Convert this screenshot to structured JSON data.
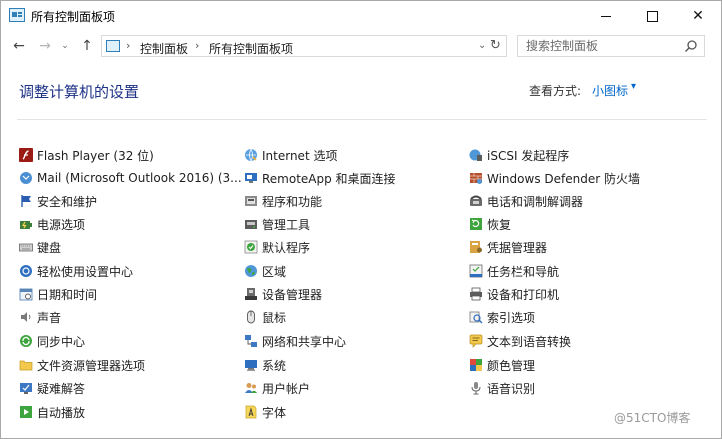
{
  "window": {
    "title": "所有控制面板项"
  },
  "titlebar": {
    "minimize": "—",
    "maximize": "□",
    "close": "✕"
  },
  "nav": {
    "back": "←",
    "forward": "→",
    "recent": "⌄",
    "up": "↑",
    "breadcrumb": [
      "控制面板",
      "所有控制面板项"
    ],
    "separator": "›",
    "refresh": "↻",
    "dropdown": "⌄"
  },
  "search": {
    "placeholder": "搜索控制面板"
  },
  "header": {
    "title": "调整计算机的设置",
    "view_label": "查看方式:",
    "view_value": "小图标",
    "view_caret": "▾"
  },
  "columns": [
    [
      {
        "label": "Flash Player (32 位)",
        "icon": "flash-icon"
      },
      {
        "label": "Mail (Microsoft Outlook 2016) (3...",
        "icon": "mail-icon"
      },
      {
        "label": "安全和维护",
        "icon": "flag-icon"
      },
      {
        "label": "电源选项",
        "icon": "power-icon"
      },
      {
        "label": "键盘",
        "icon": "keyboard-icon"
      },
      {
        "label": "轻松使用设置中心",
        "icon": "ease-of-access-icon"
      },
      {
        "label": "日期和时间",
        "icon": "calendar-icon"
      },
      {
        "label": "声音",
        "icon": "speaker-icon"
      },
      {
        "label": "同步中心",
        "icon": "sync-icon"
      },
      {
        "label": "文件资源管理器选项",
        "icon": "folder-icon"
      },
      {
        "label": "疑难解答",
        "icon": "troubleshoot-icon"
      },
      {
        "label": "自动播放",
        "icon": "autoplay-icon"
      }
    ],
    [
      {
        "label": "Internet 选项",
        "icon": "internet-icon"
      },
      {
        "label": "RemoteApp 和桌面连接",
        "icon": "remote-icon"
      },
      {
        "label": "程序和功能",
        "icon": "programs-icon"
      },
      {
        "label": "管理工具",
        "icon": "admin-tools-icon"
      },
      {
        "label": "默认程序",
        "icon": "default-programs-icon"
      },
      {
        "label": "区域",
        "icon": "region-icon"
      },
      {
        "label": "设备管理器",
        "icon": "device-manager-icon"
      },
      {
        "label": "鼠标",
        "icon": "mouse-icon"
      },
      {
        "label": "网络和共享中心",
        "icon": "network-icon"
      },
      {
        "label": "系统",
        "icon": "system-icon"
      },
      {
        "label": "用户帐户",
        "icon": "users-icon"
      },
      {
        "label": "字体",
        "icon": "fonts-icon"
      }
    ],
    [
      {
        "label": "iSCSI 发起程序",
        "icon": "iscsi-icon"
      },
      {
        "label": "Windows Defender 防火墙",
        "icon": "firewall-icon"
      },
      {
        "label": "电话和调制解调器",
        "icon": "phone-icon"
      },
      {
        "label": "恢复",
        "icon": "recovery-icon"
      },
      {
        "label": "凭据管理器",
        "icon": "credentials-icon"
      },
      {
        "label": "任务栏和导航",
        "icon": "taskbar-icon"
      },
      {
        "label": "设备和打印机",
        "icon": "printer-icon"
      },
      {
        "label": "索引选项",
        "icon": "indexing-icon"
      },
      {
        "label": "文本到语音转换",
        "icon": "text-to-speech-icon"
      },
      {
        "label": "颜色管理",
        "icon": "color-management-icon"
      },
      {
        "label": "语音识别",
        "icon": "microphone-icon"
      }
    ]
  ],
  "watermark": "@51CTO博客"
}
